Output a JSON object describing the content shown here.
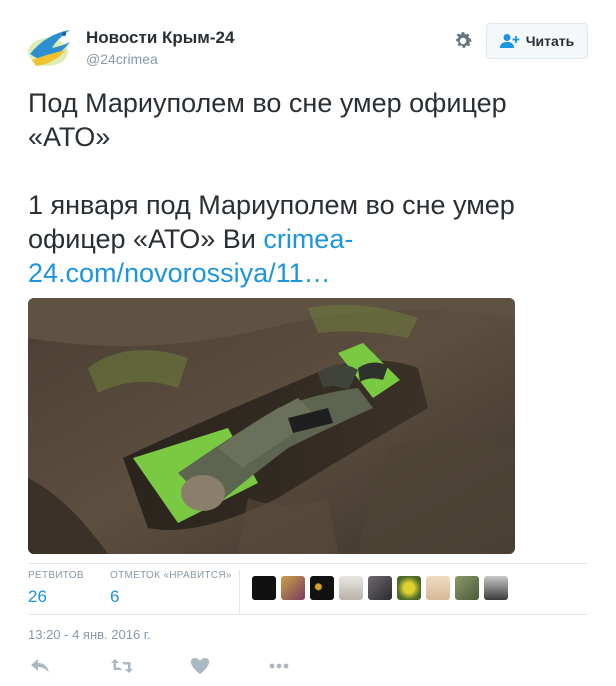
{
  "account": {
    "name": "Новости Крым-24",
    "handle": "@24crimea",
    "follow_label": "Читать"
  },
  "tweet": {
    "title_line": "Под Мариуполем во сне умер офицер «АТО»",
    "body_text": "1 января под Мариуполем во сне умер офицер «АТО» Ви ",
    "link_text": "crimea-24.com/novorossiya/11…"
  },
  "stats": {
    "retweets_label": "РЕТВИТОВ",
    "retweets_value": "26",
    "likes_label": "ОТМЕТОК «НРАВИТСЯ»",
    "likes_value": "6"
  },
  "timestamp": "13:20 - 4 янв. 2016 г.",
  "colors": {
    "link": "#1b95e0",
    "text": "#292f33",
    "muted": "#8899a6",
    "border": "#e1e8ed"
  },
  "icons": [
    "bird-logo-icon",
    "gear-icon",
    "follow-person-icon",
    "reply-icon",
    "retweet-icon",
    "like-icon",
    "more-icon"
  ]
}
